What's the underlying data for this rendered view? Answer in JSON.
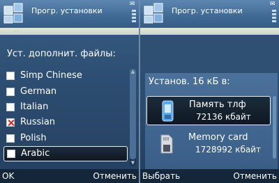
{
  "left": {
    "title": "Прогр. установки",
    "heading": "Уст. дополнит. файлы:",
    "items": [
      {
        "label": "Simp Chinese",
        "checked": false
      },
      {
        "label": "German",
        "checked": false
      },
      {
        "label": "Italian",
        "checked": false
      },
      {
        "label": "Russian",
        "checked": true
      },
      {
        "label": "Polish",
        "checked": false
      },
      {
        "label": "Arabic",
        "checked": false
      }
    ],
    "softkey_left": "OK",
    "softkey_right": "Отменить"
  },
  "right": {
    "title": "Прогр. установки",
    "popup_title": "Установ. 16 кБ в:",
    "options": [
      {
        "name": "Память тлф",
        "size": "72136 кбайт",
        "icon": "phone-memory-icon"
      },
      {
        "name": "Memory card",
        "size": "1728992 кбайт",
        "icon": "memory-card-icon"
      }
    ],
    "softkey_left": "Выбрать",
    "softkey_right": "Отменить"
  },
  "colors": {
    "accent": "#e8eef5",
    "checked_mark": "#d22222"
  }
}
